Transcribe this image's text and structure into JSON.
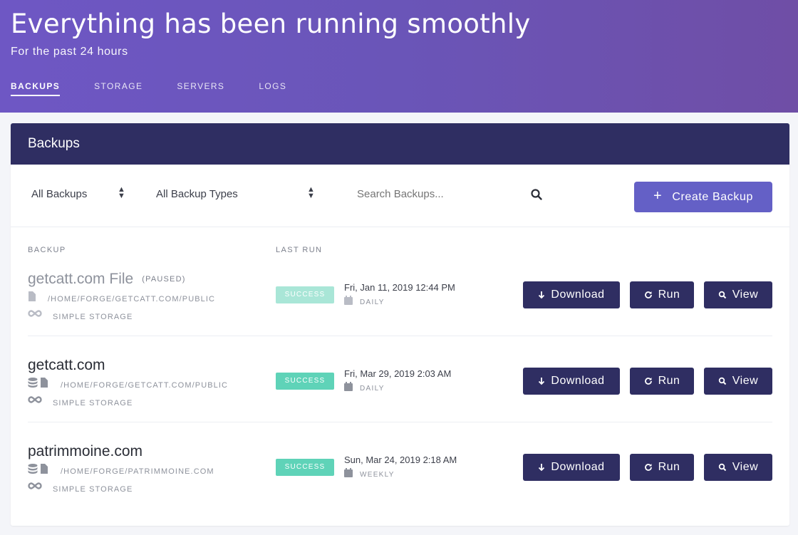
{
  "header": {
    "title": "Everything has been running smoothly",
    "subtitle": "For the past 24 hours",
    "tabs": [
      "BACKUPS",
      "STORAGE",
      "SERVERS",
      "LOGS"
    ],
    "active_tab": "BACKUPS",
    "gradient": [
      "#6e57c4",
      "#6f4ea6"
    ]
  },
  "card": {
    "title": "Backups",
    "filters": {
      "backup_filter": "All Backups",
      "type_filter": "All Backup Types",
      "search_placeholder": "Search Backups...",
      "create_label": "Create Backup"
    },
    "columns": [
      "BACKUP",
      "LAST RUN"
    ],
    "rows": [
      {
        "name": "getcatt.com File",
        "tag": "(PAUSED)",
        "path": "/HOME/FORGE/GETCATT.COM/PUBLIC",
        "storage": "SIMPLE STORAGE",
        "status": "SUCCESS",
        "date": "Fri, Jan 11, 2019 12:44 PM",
        "frequency": "DAILY"
      },
      {
        "name": "getcatt.com",
        "tag": "",
        "path": "/HOME/FORGE/GETCATT.COM/PUBLIC",
        "storage": "SIMPLE STORAGE",
        "status": "SUCCESS",
        "date": "Fri, Mar 29, 2019 2:03 AM",
        "frequency": "DAILY"
      },
      {
        "name": "patrimmoine.com",
        "tag": "",
        "path": "/HOME/FORGE/PATRIMMOINE.COM",
        "storage": "SIMPLE STORAGE",
        "status": "SUCCESS",
        "date": "Sun, Mar 24, 2019 2:18 AM",
        "frequency": "WEEKLY"
      }
    ],
    "actions": {
      "download": "Download",
      "run": "Run",
      "view": "View"
    }
  },
  "colors": {
    "accent": "#6460c6",
    "navy": "#2f2e62",
    "success": "#5fd3b8"
  }
}
